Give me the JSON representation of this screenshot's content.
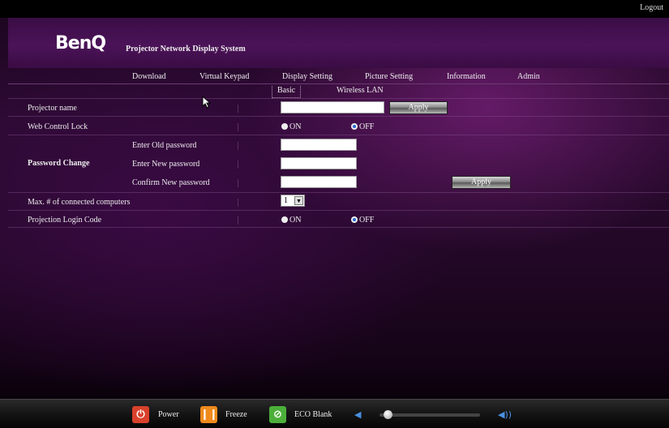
{
  "top": {
    "logout": "Logout"
  },
  "header": {
    "logo": "BenQ",
    "subtitle": "Projector Network Display System"
  },
  "nav": {
    "items": [
      "Download",
      "Virtual Keypad",
      "Display Setting",
      "Picture Setting",
      "Information",
      "Admin"
    ]
  },
  "subtabs": {
    "items": [
      "Basic",
      "Wireless LAN"
    ],
    "active": "Basic"
  },
  "form": {
    "projector_name": {
      "label": "Projector name",
      "value": "",
      "apply": "Apply"
    },
    "web_control_lock": {
      "label": "Web Control Lock",
      "on": "ON",
      "off": "OFF",
      "selected": "OFF"
    },
    "password_change": {
      "label": "Password Change",
      "old_label": "Enter Old password",
      "new_label": "Enter New password",
      "confirm_label": "Confirm New password",
      "apply": "Apply"
    },
    "max_computers": {
      "label": "Max. # of connected computers",
      "value": "1"
    },
    "login_code": {
      "label": "Projection Login Code",
      "on": "ON",
      "off": "OFF",
      "selected": "OFF"
    }
  },
  "bottombar": {
    "power": "Power",
    "freeze": "Freeze",
    "eco_blank": "ECO Blank",
    "volume_level": 0.08
  },
  "colors": {
    "power": "#d9412b",
    "freeze": "#f08a1c",
    "eco": "#4caf3a",
    "volume": "#4a90e2"
  }
}
